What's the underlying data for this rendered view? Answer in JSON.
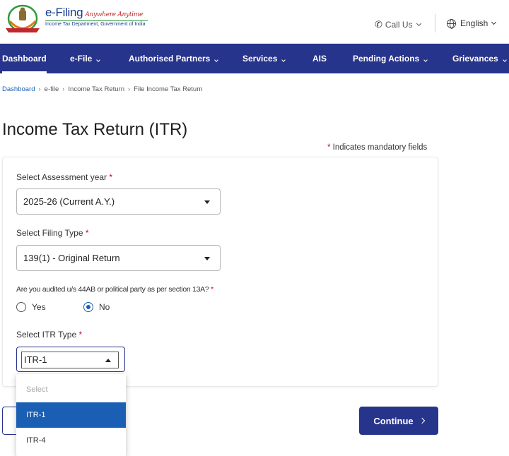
{
  "header": {
    "logo_title": "e-Filing",
    "logo_tagline": "Anywhere Anytime",
    "logo_subtitle": "Income Tax Department, Government of India",
    "call_us": "Call Us",
    "language": "English"
  },
  "nav": {
    "items": [
      {
        "label": "Dashboard",
        "has_menu": false,
        "active": true
      },
      {
        "label": "e-File",
        "has_menu": true
      },
      {
        "label": "Authorised Partners",
        "has_menu": true
      },
      {
        "label": "Services",
        "has_menu": true
      },
      {
        "label": "AIS",
        "has_menu": false
      },
      {
        "label": "Pending Actions",
        "has_menu": true
      },
      {
        "label": "Grievances",
        "has_menu": true
      }
    ]
  },
  "breadcrumb": [
    "Dashboard",
    "e-file",
    "Income Tax Return",
    "File Income Tax Return"
  ],
  "page": {
    "title": "Income Tax Return (ITR)",
    "mandatory_note": "Indicates mandatory fields"
  },
  "form": {
    "assessment_year": {
      "label": "Select Assessment year",
      "value": "2025-26  (Current A.Y.)"
    },
    "filing_type": {
      "label": "Select Filing Type",
      "value": "139(1) - Original Return"
    },
    "audit_question": "Are you audited u/s 44AB or political party as per section 13A?",
    "audit_options": {
      "yes": "Yes",
      "no": "No",
      "selected": "No"
    },
    "itr_type": {
      "label": "Select ITR Type",
      "value": "ITR-1"
    }
  },
  "dropdown": {
    "options": [
      "Select",
      "ITR-1",
      "ITR-4"
    ],
    "selected": "ITR-1"
  },
  "buttons": {
    "continue": "Continue"
  },
  "colors": {
    "nav_bg": "#27348b",
    "accent": "#1a5fb4",
    "required": "#d0021b"
  }
}
